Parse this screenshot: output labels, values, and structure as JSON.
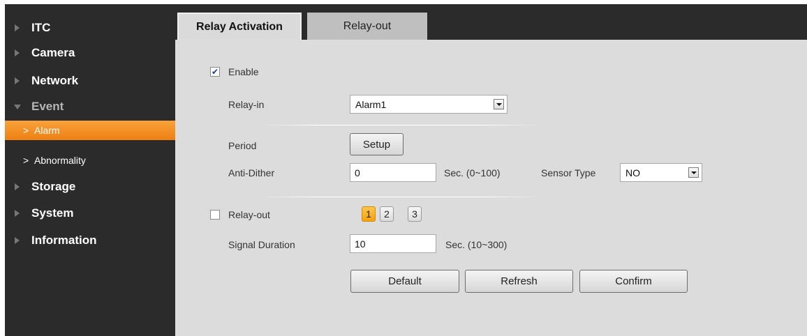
{
  "sidebar": {
    "items": [
      {
        "label": "ITC"
      },
      {
        "label": "Camera"
      },
      {
        "label": "Network"
      },
      {
        "label": "Event"
      },
      {
        "label": "Storage"
      },
      {
        "label": "System"
      },
      {
        "label": "Information"
      }
    ],
    "sub_items": [
      {
        "label": "Alarm",
        "active": true
      },
      {
        "label": "Abnormality",
        "active": false
      }
    ]
  },
  "tabs": [
    {
      "label": "Relay Activation",
      "active": true
    },
    {
      "label": "Relay-out",
      "active": false
    }
  ],
  "form": {
    "enable_label": "Enable",
    "enable_checked": true,
    "relay_in_label": "Relay-in",
    "relay_in_value": "Alarm1",
    "period_label": "Period",
    "setup_label": "Setup",
    "anti_dither_label": "Anti-Dither",
    "anti_dither_value": "0",
    "anti_dither_unit": "Sec. (0~100)",
    "sensor_type_label": "Sensor Type",
    "sensor_type_value": "NO",
    "relay_out_label": "Relay-out",
    "relay_out_checked": false,
    "channels": [
      "1",
      "2",
      "3"
    ],
    "active_channel": "1",
    "signal_duration_label": "Signal Duration",
    "signal_duration_value": "10",
    "signal_duration_unit": "Sec. (10~300)"
  },
  "buttons": {
    "default_label": "Default",
    "refresh_label": "Refresh",
    "confirm_label": "Confirm"
  },
  "colors": {
    "sidebar_bg": "#2b2b2b",
    "active_item": "#f39423",
    "content_bg": "#dcdcdc"
  }
}
